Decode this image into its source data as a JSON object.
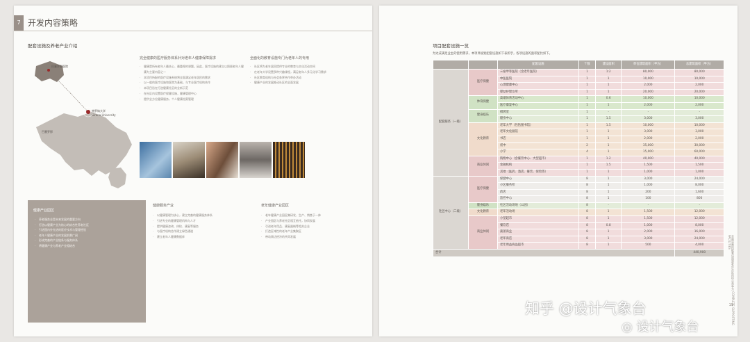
{
  "left_page": {
    "header_mark": "7",
    "title": "开发内容策略",
    "section_title": "配套设施及养老产业介绍",
    "map": {
      "labels": [
        "巴塞罗那医院",
        "赫罗纳大学",
        "Girona University",
        "巴塞罗那"
      ]
    },
    "col1_title": "完全健康的医疗服务体系针对老年人健康保障需求",
    "col1_bullets": [
      "健康是所有老年人最关心、最重视的课题。因此，医疗设施的建立以照顾老年人健康为主要内容之一",
      "本项目所配的医疗设施系统将全面满足老年居民的需求",
      "以一般的医疗设施和医院为基础，与专业医疗机构合作",
      "本项目旨在打造健康社区的全新示范",
      "在社区内设置医疗保健设施，健康管理中心",
      "提供全方位健康服务，个人健康档案管理"
    ],
    "col2_title": "全面化的教育设施专门为老年人的专用",
    "col2_bullets": [
      "社区将为老年居民提供专业的教育与文化活动空间",
      "在老年大学设置多种兴趣课程，满足老年人多元化学习需求",
      "社区教育机构与社会各界合作举办活动",
      "健康产业的发展推动社区的全面发展"
    ],
    "greybox": {
      "title": "健康产业园区",
      "bullets": [
        "养老服务业是未来发展的重要方向",
        "打造以健康产业为核心的综合性养老社区",
        "引进国内外先进的医疗技术与管理经验",
        "老年人健康产业的发展前景广阔",
        "形成完善的产业链条与服务体系",
        "将健康产业与养老产业相结合"
      ]
    },
    "col3_title": "健康服务产业",
    "col3_bullets": [
      "以健康管理为核心，建立完善的健康服务体系",
      "引进专业的健康管理机构与人才",
      "提供健康咨询、体检、康复等服务",
      "与医疗机构合作建立绿色通道",
      "建立老年人健康数据库"
    ],
    "col4_title": "老年健康产业园区",
    "col4_bullets": [
      "老年健康产业园区集研发、生产、销售于一体",
      "产业园区与养老社区相互依托，协同发展",
      "引进老年用品、康复器械等相关企业",
      "打造区域性的老年产业集聚区",
      "带动周边经济的共同发展"
    ]
  },
  "right_page": {
    "section_title": "项目配套设施一览",
    "intro": "为达成满足业主的使用需求，本项目规划配套设施如下表所示，各项设施的面积配比如下。",
    "table": {
      "headers": [
        "",
        "",
        "配套设施",
        "个数",
        "建设面积",
        "单位建筑面积（平方）",
        "总建筑面积（平方）"
      ],
      "rows": [
        {
          "l1": "",
          "l2": "医疗保健",
          "name": "三级甲等医院（含老年医院）",
          "n": "1",
          "area": "1:2",
          "unit": "80,000",
          "total": "80,000",
          "tone": "pk"
        },
        {
          "l1": "",
          "l2": "",
          "name": "中医医院",
          "n": "1",
          "area": "1",
          "unit": "10,000",
          "total": "10,000",
          "tone": "pk"
        },
        {
          "l1": "",
          "l2": "",
          "name": "心理健康中心",
          "n": "1",
          "area": "1",
          "unit": "2,000",
          "total": "2,000",
          "tone": "pk"
        },
        {
          "l1": "",
          "l2": "",
          "name": "婴幼护理诊所",
          "n": "1",
          "area": "1",
          "unit": "20,000",
          "total": "20,000",
          "tone": "pk"
        },
        {
          "l1": "",
          "l2": "体育保健",
          "name": "高端体育活动中心",
          "n": "1",
          "area": "0.6",
          "unit": "10,000",
          "total": "10,000",
          "tone": "gr"
        },
        {
          "l1": "",
          "l2": "",
          "name": "医疗康复中心",
          "n": "1",
          "area": "1",
          "unit": "2,000",
          "total": "2,000",
          "tone": "gr"
        },
        {
          "l1": "",
          "l2": "健身娱乐",
          "name": "棋牌室",
          "n": "1",
          "area": "-",
          "unit": "-",
          "total": "-",
          "tone": "gr2"
        },
        {
          "l1": "配套服务（一级）",
          "l2": "",
          "name": "健身中心",
          "n": "1",
          "area": "1.5",
          "unit": "3,000",
          "total": "3,000",
          "tone": "gr2"
        },
        {
          "l1": "",
          "l2": "文化教育",
          "name": "老年大学（包括图书馆）",
          "n": "1",
          "area": "1.5",
          "unit": "10,000",
          "total": "10,000",
          "tone": "pe"
        },
        {
          "l1": "",
          "l2": "",
          "name": "老年文化展馆",
          "n": "1",
          "area": "1",
          "unit": "3,000",
          "total": "3,000",
          "tone": "pe"
        },
        {
          "l1": "",
          "l2": "",
          "name": "书店",
          "n": "1",
          "area": "1",
          "unit": "2,000",
          "total": "2,000",
          "tone": "pe"
        },
        {
          "l1": "",
          "l2": "",
          "name": "初中",
          "n": "2",
          "area": "1",
          "unit": "35,000",
          "total": "30,000",
          "tone": "pe"
        },
        {
          "l1": "",
          "l2": "",
          "name": "小学",
          "n": "4",
          "area": "1",
          "unit": "15,000",
          "total": "60,000",
          "tone": "pe"
        },
        {
          "l1": "",
          "l2": "商业休闲",
          "name": "购物中心（含餐饮中心、大型超市）",
          "n": "1",
          "area": "1.2",
          "unit": "40,000",
          "total": "40,000",
          "tone": "pk"
        },
        {
          "l1": "",
          "l2": "",
          "name": "金融机构",
          "n": "1",
          "area": "1.5",
          "unit": "1,500",
          "total": "1,500",
          "tone": "pk"
        },
        {
          "l1": "",
          "l2": "",
          "name": "其他（医药、酒店、餐饮、保险等）",
          "n": "1",
          "area": "1",
          "unit": "1,000",
          "total": "1,000",
          "tone": "pk"
        },
        {
          "l1": "",
          "l2": "医疗保健",
          "name": "保健中心",
          "n": "8",
          "area": "1",
          "unit": "3,000",
          "total": "24,000",
          "tone": "wt"
        },
        {
          "l1": "",
          "l2": "",
          "name": "小区服务所",
          "n": "8",
          "area": "1",
          "unit": "1,000",
          "total": "8,000",
          "tone": "wt"
        },
        {
          "l1": "",
          "l2": "",
          "name": "药店",
          "n": "8",
          "area": "1",
          "unit": "200",
          "total": "1,600",
          "tone": "wt"
        },
        {
          "l1": "",
          "l2": "",
          "name": "监控中心",
          "n": "8",
          "area": "1",
          "unit": "100",
          "total": "800",
          "tone": "wt"
        },
        {
          "l1": "",
          "l2": "健身娱乐",
          "name": "社区活动场地（公园）",
          "n": "8",
          "area": "-",
          "unit": "-",
          "total": "-",
          "tone": "gr2"
        },
        {
          "l1": "社区中心（二级）",
          "l2": "文化教育",
          "name": "老年活动场",
          "n": "8",
          "area": "1",
          "unit": "1,500",
          "total": "12,000",
          "tone": "pe"
        },
        {
          "l1": "",
          "l2": "商业休闲",
          "name": "小型超市",
          "n": "8",
          "area": "1",
          "unit": "1,500",
          "total": "12,000",
          "tone": "pk"
        },
        {
          "l1": "",
          "l2": "",
          "name": "餐饮店",
          "n": "8",
          "area": "0.8",
          "unit": "1,000",
          "total": "8,000",
          "tone": "pk"
        },
        {
          "l1": "",
          "l2": "",
          "name": "蔬菜商业",
          "n": "8",
          "area": "1",
          "unit": "2,000",
          "total": "16,000",
          "tone": "pk"
        },
        {
          "l1": "",
          "l2": "",
          "name": "老年商店",
          "n": "8",
          "area": "1",
          "unit": "3,000",
          "total": "24,000",
          "tone": "pk"
        },
        {
          "l1": "",
          "l2": "",
          "name": "老年用品商品超市",
          "n": "8",
          "area": "1",
          "unit": "500",
          "total": "4,000",
          "tone": "pk"
        }
      ],
      "total_label": "合计",
      "total_value": "440,900"
    },
    "vertical_text": "全面完善的配套设施是老年社区的核心竞争力 COMPLETE SUPPORTING FACILITIES",
    "page_number": "19"
  },
  "watermark": {
    "line1": "知乎 @设计气象台",
    "line2": "设计气象台"
  }
}
